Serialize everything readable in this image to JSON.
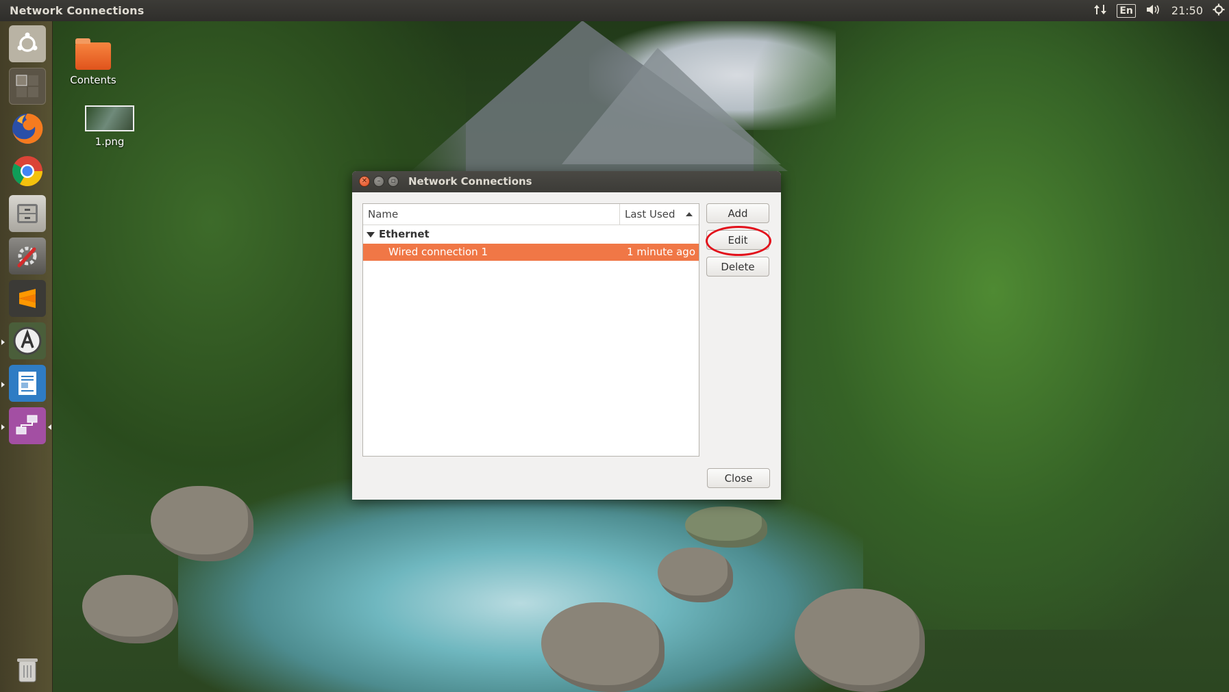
{
  "top_panel": {
    "app_title": "Network Connections",
    "indicators": {
      "network_icon": "network-up-down-icon",
      "keyboard_layout": "En",
      "volume_icon": "speaker-icon",
      "clock": "21:50",
      "settings_icon": "gear-icon"
    }
  },
  "launcher": {
    "items": [
      {
        "name": "search-dash",
        "icon": "ubuntu-logo-icon"
      },
      {
        "name": "workspace-switcher",
        "icon": "workspace-icon"
      },
      {
        "name": "firefox",
        "icon": "firefox-icon"
      },
      {
        "name": "chrome",
        "icon": "chrome-icon"
      },
      {
        "name": "files",
        "icon": "file-cabinet-icon"
      },
      {
        "name": "system-settings",
        "icon": "wrench-icon"
      },
      {
        "name": "sublime-text",
        "icon": "sublime-icon"
      },
      {
        "name": "software-updater",
        "icon": "updater-icon"
      },
      {
        "name": "libreoffice-writer",
        "icon": "document-icon"
      },
      {
        "name": "network-connections",
        "icon": "network-icon"
      },
      {
        "name": "trash",
        "icon": "trash-icon"
      }
    ]
  },
  "desktop": {
    "icons": [
      {
        "label": "Contents",
        "icon": "folder-icon"
      },
      {
        "label": "1.png",
        "icon": "image-thumbnail-icon"
      }
    ]
  },
  "dialog": {
    "title": "Network Connections",
    "columns": {
      "name": "Name",
      "last_used": "Last Used"
    },
    "groups": [
      {
        "label": "Ethernet",
        "connections": [
          {
            "name": "Wired connection 1",
            "last_used": "1 minute ago",
            "selected": true
          }
        ]
      }
    ],
    "buttons": {
      "add": "Add",
      "edit": "Edit",
      "delete": "Delete",
      "close": "Close"
    },
    "selection_color": "#f07746",
    "highlight_color": "#e2101b"
  }
}
